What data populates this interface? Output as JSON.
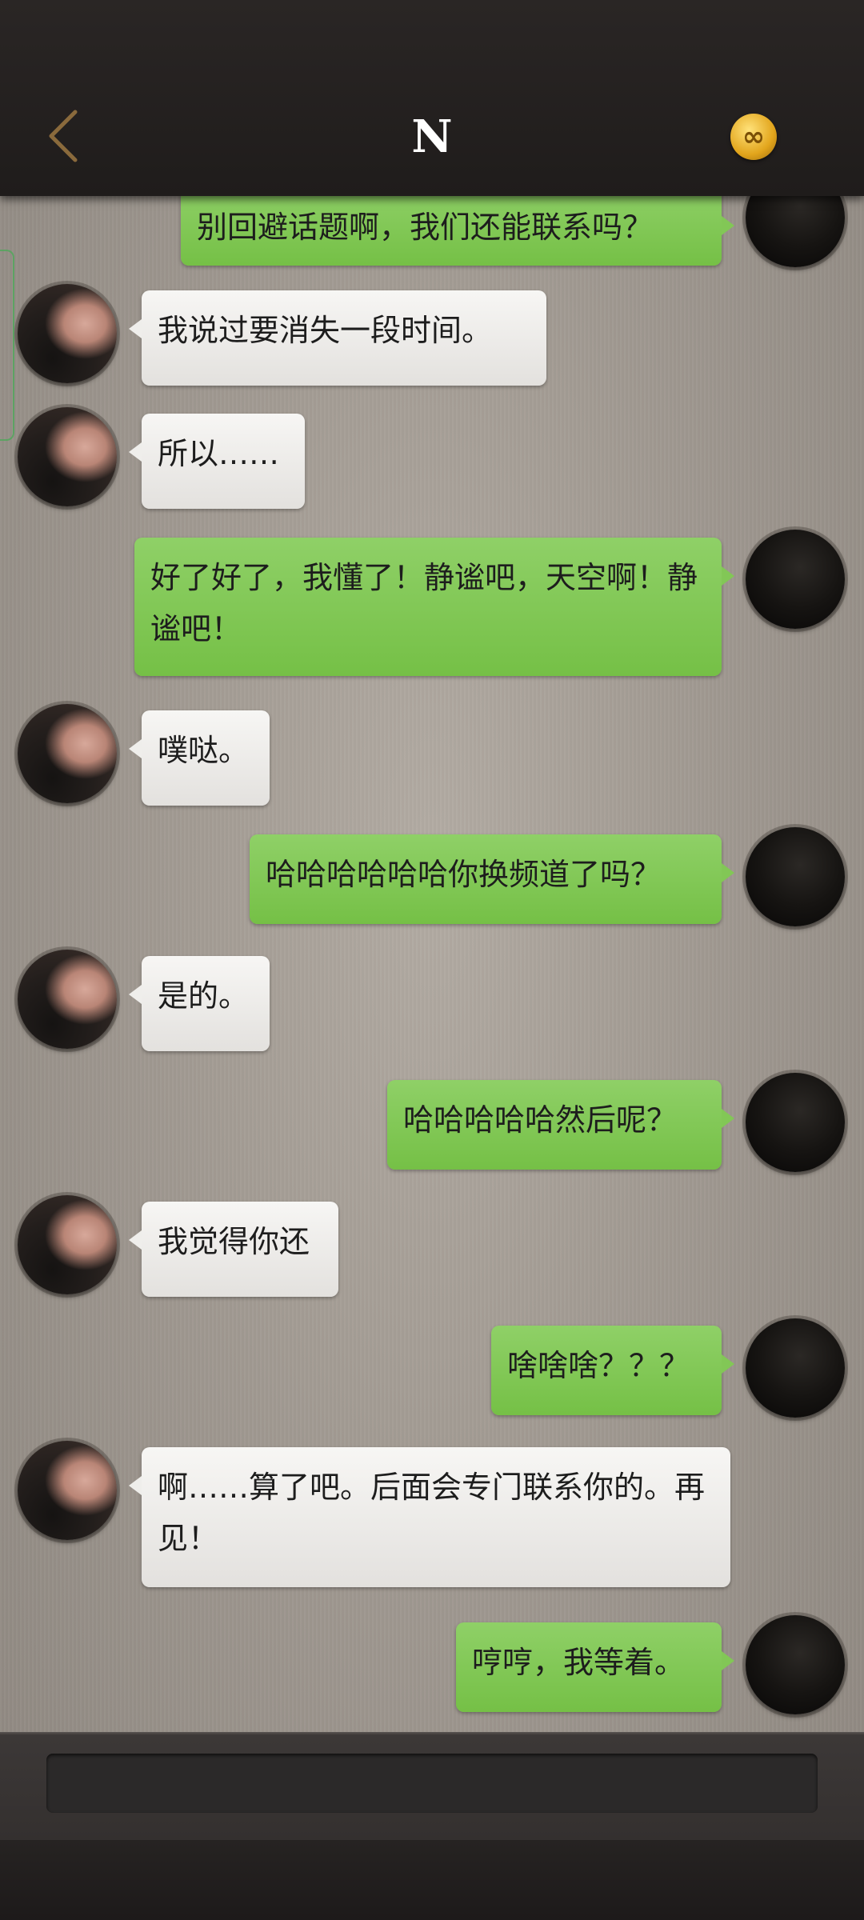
{
  "header": {
    "title": "N",
    "back_icon": "chevron-left-icon",
    "badge_icon": "infinity-icon",
    "badge_glyph": "∞"
  },
  "messages": [
    {
      "side": "out",
      "text": "别回避话题啊，我们还能联系吗？"
    },
    {
      "side": "in",
      "text": "我说过要消失一段时间。"
    },
    {
      "side": "in",
      "text": "所以……"
    },
    {
      "side": "out",
      "text": "好了好了，我懂了！静谧吧，天空啊！静谧吧！"
    },
    {
      "side": "in",
      "text": "噗哒。"
    },
    {
      "side": "out",
      "text": "哈哈哈哈哈哈你换频道了吗？"
    },
    {
      "side": "in",
      "text": "是的。"
    },
    {
      "side": "out",
      "text": "哈哈哈哈哈然后呢？"
    },
    {
      "side": "in",
      "text": "我觉得你还"
    },
    {
      "side": "out",
      "text": "啥啥啥？？？"
    },
    {
      "side": "in",
      "text": "啊……算了吧。后面会专门联系你的。再见！"
    },
    {
      "side": "out",
      "text": "哼哼，我等着。"
    }
  ],
  "input": {
    "value": "",
    "placeholder": ""
  },
  "colors": {
    "outgoing_bubble": "#82c756",
    "incoming_bubble": "#efeeeb",
    "header": "#231f1e",
    "badge": "#e2a51c"
  }
}
